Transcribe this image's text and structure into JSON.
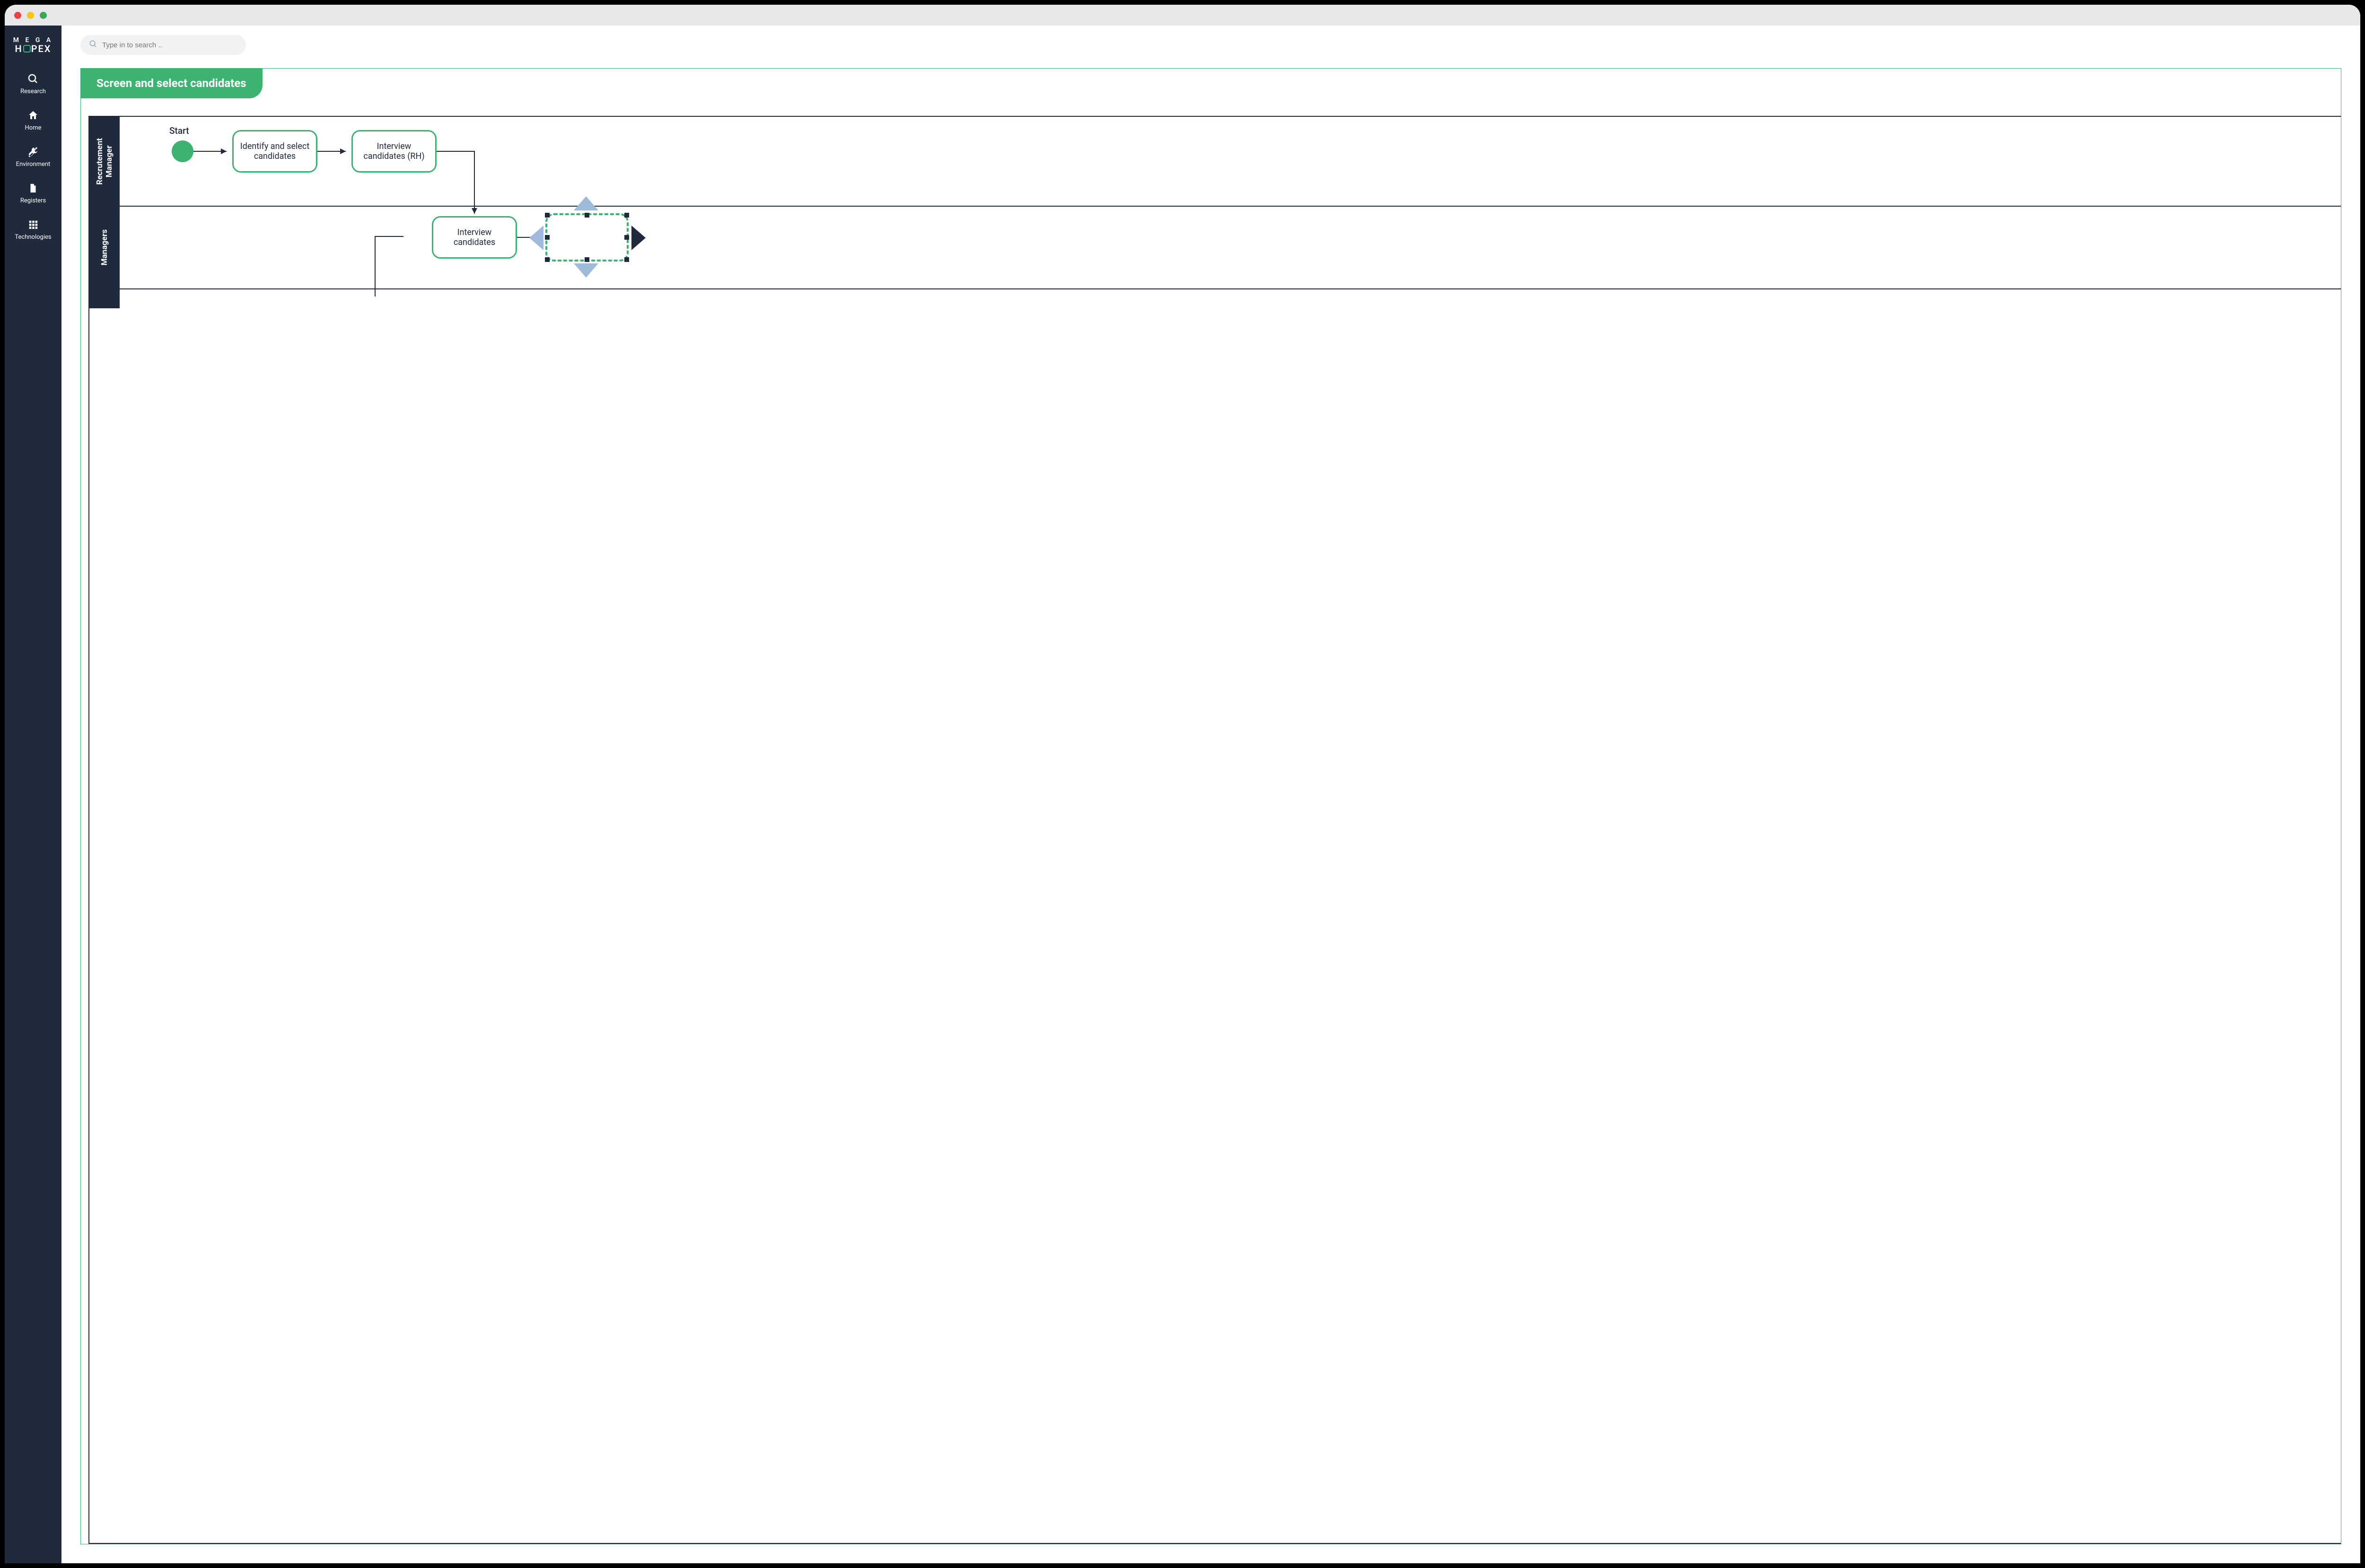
{
  "app": {
    "name_top": "M E G A",
    "name_bottom_left": "H",
    "name_bottom_right": "PEX"
  },
  "search": {
    "placeholder": "Type in to search .."
  },
  "sidebar": {
    "items": [
      {
        "id": "research",
        "label": "Research"
      },
      {
        "id": "home",
        "label": "Home"
      },
      {
        "id": "environment",
        "label": "Environment"
      },
      {
        "id": "registers",
        "label": "Registers"
      },
      {
        "id": "technologies",
        "label": "Technologies"
      }
    ]
  },
  "diagram": {
    "title": "Screen and select candidates",
    "lanes": [
      {
        "id": "recruitment-manager",
        "label": "Recrutement\nManager"
      },
      {
        "id": "managers",
        "label": "Managers"
      }
    ],
    "start_label": "Start",
    "tasks": {
      "identify": "Identify and select candidates",
      "interview_rh": "Interview candidates (RH)",
      "interview": "Interview candidates"
    }
  },
  "colors": {
    "accent": "#3cb371",
    "dark": "#1f2a3c",
    "arrow_light": "#9fbbdc"
  }
}
